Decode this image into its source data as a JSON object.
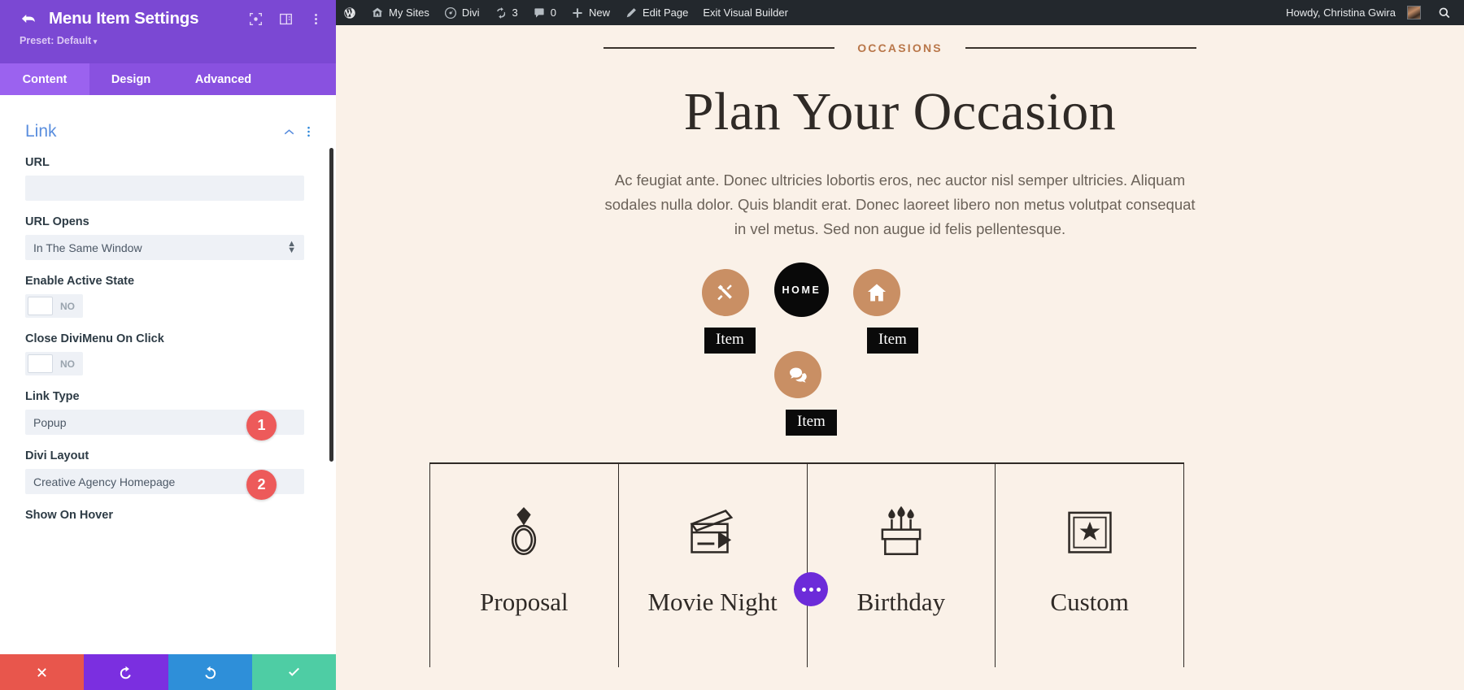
{
  "settings": {
    "title": "Menu Item Settings",
    "preset_label": "Preset: Default",
    "back_icon": "back-arrow-icon",
    "header_icons": [
      "fullscreen-icon",
      "layout-panel-icon",
      "kebab-menu-icon"
    ],
    "tabs": [
      {
        "label": "Content",
        "active": true
      },
      {
        "label": "Design",
        "active": false
      },
      {
        "label": "Advanced",
        "active": false
      }
    ],
    "section": {
      "title": "Link",
      "collapse_icon": "chevron-up-icon",
      "more_icon": "kebab-menu-icon"
    },
    "fields": [
      {
        "label": "URL",
        "type": "text",
        "value": "",
        "placeholder": ""
      },
      {
        "label": "URL Opens",
        "type": "select",
        "value": "In The Same Window"
      },
      {
        "label": "Enable Active State",
        "type": "toggle",
        "value": "NO"
      },
      {
        "label": "Close DiviMenu On Click",
        "type": "toggle",
        "value": "NO"
      },
      {
        "label": "Link Type",
        "type": "select",
        "value": "Popup",
        "badge": "1"
      },
      {
        "label": "Divi Layout",
        "type": "select",
        "value": "Creative Agency Homepage",
        "badge": "2"
      },
      {
        "label": "Show On Hover",
        "type": "label-only",
        "value": ""
      }
    ],
    "actions": [
      {
        "name": "cancel",
        "icon": "close-x-icon",
        "color": "#e8564c"
      },
      {
        "name": "undo",
        "icon": "undo-arrow-icon",
        "color": "#7b2fe0"
      },
      {
        "name": "redo",
        "icon": "redo-arrow-icon",
        "color": "#2e8fd9"
      },
      {
        "name": "save",
        "icon": "checkmark-icon",
        "color": "#4ecda4"
      }
    ]
  },
  "adminbar": {
    "items": [
      {
        "label": "",
        "icon": "wordpress-logo-icon"
      },
      {
        "label": "My Sites",
        "icon": "multisite-icon"
      },
      {
        "label": "Divi",
        "icon": "divi-gauge-icon"
      },
      {
        "label": "3",
        "icon": "updates-refresh-icon"
      },
      {
        "label": "0",
        "icon": "comment-bubble-icon"
      },
      {
        "label": "New",
        "icon": "plus-icon"
      },
      {
        "label": "Edit Page",
        "icon": "pencil-icon"
      },
      {
        "label": "Exit Visual Builder",
        "icon": ""
      }
    ],
    "greeting": "Howdy, Christina Gwira",
    "avatar_icon": "user-avatar",
    "search_icon": "search-icon"
  },
  "content": {
    "eyebrow": "OCCASIONS",
    "heading": "Plan Your Occasion",
    "paragraph": "Ac feugiat ante. Donec ultricies lobortis eros, nec auctor nisl semper ultricies. Aliquam sodales nulla dolor. Quis blandit erat. Donec laoreet libero non metus volutpat consequat in vel metus. Sed non augue id felis pellentesque.",
    "menu_circles": [
      {
        "icon": "tools-wrench-screwdriver-icon",
        "style": "tan",
        "label": "Item"
      },
      {
        "icon": "",
        "text": "HOME",
        "style": "black",
        "label": ""
      },
      {
        "icon": "home-house-icon",
        "style": "tan",
        "label": "Item"
      },
      {
        "icon": "chat-bubbles-icon",
        "style": "tan",
        "label": "Item"
      }
    ],
    "cards": [
      {
        "title": "Proposal",
        "icon": "engagement-ring-icon"
      },
      {
        "title": "Movie Night",
        "icon": "clapperboard-icon"
      },
      {
        "title": "Birthday",
        "icon": "birthday-cake-icon"
      },
      {
        "title": "Custom",
        "icon": "gift-star-box-icon"
      }
    ],
    "fab_icon": "ellipsis-dots-icon"
  },
  "colors": {
    "panel_header": "#7b48d3",
    "tab_active": "#9b62ef",
    "badge": "#ed5a5a",
    "accent_tan": "#c98f64",
    "eyebrow": "#b9774a",
    "page_bg": "#faf1e8",
    "dark": "#2f2a26"
  }
}
